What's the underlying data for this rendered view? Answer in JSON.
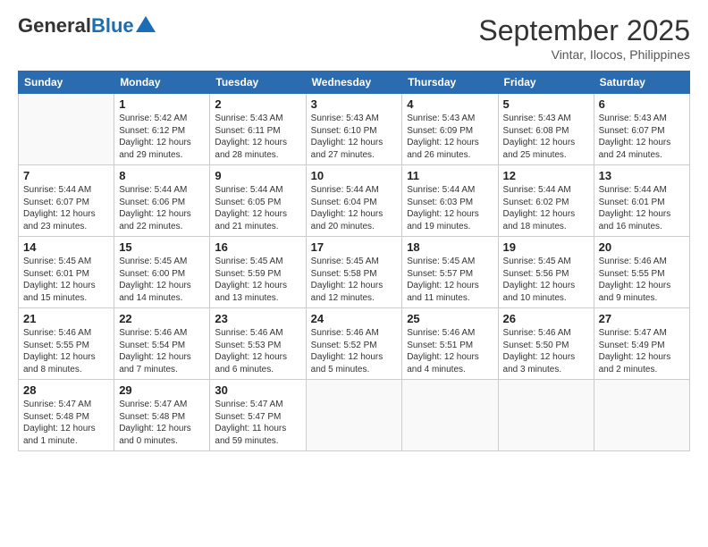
{
  "header": {
    "logo_general": "General",
    "logo_blue": "Blue",
    "month": "September 2025",
    "location": "Vintar, Ilocos, Philippines"
  },
  "days_of_week": [
    "Sunday",
    "Monday",
    "Tuesday",
    "Wednesday",
    "Thursday",
    "Friday",
    "Saturday"
  ],
  "weeks": [
    [
      {
        "day": "",
        "info": ""
      },
      {
        "day": "1",
        "info": "Sunrise: 5:42 AM\nSunset: 6:12 PM\nDaylight: 12 hours\nand 29 minutes."
      },
      {
        "day": "2",
        "info": "Sunrise: 5:43 AM\nSunset: 6:11 PM\nDaylight: 12 hours\nand 28 minutes."
      },
      {
        "day": "3",
        "info": "Sunrise: 5:43 AM\nSunset: 6:10 PM\nDaylight: 12 hours\nand 27 minutes."
      },
      {
        "day": "4",
        "info": "Sunrise: 5:43 AM\nSunset: 6:09 PM\nDaylight: 12 hours\nand 26 minutes."
      },
      {
        "day": "5",
        "info": "Sunrise: 5:43 AM\nSunset: 6:08 PM\nDaylight: 12 hours\nand 25 minutes."
      },
      {
        "day": "6",
        "info": "Sunrise: 5:43 AM\nSunset: 6:07 PM\nDaylight: 12 hours\nand 24 minutes."
      }
    ],
    [
      {
        "day": "7",
        "info": "Sunrise: 5:44 AM\nSunset: 6:07 PM\nDaylight: 12 hours\nand 23 minutes."
      },
      {
        "day": "8",
        "info": "Sunrise: 5:44 AM\nSunset: 6:06 PM\nDaylight: 12 hours\nand 22 minutes."
      },
      {
        "day": "9",
        "info": "Sunrise: 5:44 AM\nSunset: 6:05 PM\nDaylight: 12 hours\nand 21 minutes."
      },
      {
        "day": "10",
        "info": "Sunrise: 5:44 AM\nSunset: 6:04 PM\nDaylight: 12 hours\nand 20 minutes."
      },
      {
        "day": "11",
        "info": "Sunrise: 5:44 AM\nSunset: 6:03 PM\nDaylight: 12 hours\nand 19 minutes."
      },
      {
        "day": "12",
        "info": "Sunrise: 5:44 AM\nSunset: 6:02 PM\nDaylight: 12 hours\nand 18 minutes."
      },
      {
        "day": "13",
        "info": "Sunrise: 5:44 AM\nSunset: 6:01 PM\nDaylight: 12 hours\nand 16 minutes."
      }
    ],
    [
      {
        "day": "14",
        "info": "Sunrise: 5:45 AM\nSunset: 6:01 PM\nDaylight: 12 hours\nand 15 minutes."
      },
      {
        "day": "15",
        "info": "Sunrise: 5:45 AM\nSunset: 6:00 PM\nDaylight: 12 hours\nand 14 minutes."
      },
      {
        "day": "16",
        "info": "Sunrise: 5:45 AM\nSunset: 5:59 PM\nDaylight: 12 hours\nand 13 minutes."
      },
      {
        "day": "17",
        "info": "Sunrise: 5:45 AM\nSunset: 5:58 PM\nDaylight: 12 hours\nand 12 minutes."
      },
      {
        "day": "18",
        "info": "Sunrise: 5:45 AM\nSunset: 5:57 PM\nDaylight: 12 hours\nand 11 minutes."
      },
      {
        "day": "19",
        "info": "Sunrise: 5:45 AM\nSunset: 5:56 PM\nDaylight: 12 hours\nand 10 minutes."
      },
      {
        "day": "20",
        "info": "Sunrise: 5:46 AM\nSunset: 5:55 PM\nDaylight: 12 hours\nand 9 minutes."
      }
    ],
    [
      {
        "day": "21",
        "info": "Sunrise: 5:46 AM\nSunset: 5:55 PM\nDaylight: 12 hours\nand 8 minutes."
      },
      {
        "day": "22",
        "info": "Sunrise: 5:46 AM\nSunset: 5:54 PM\nDaylight: 12 hours\nand 7 minutes."
      },
      {
        "day": "23",
        "info": "Sunrise: 5:46 AM\nSunset: 5:53 PM\nDaylight: 12 hours\nand 6 minutes."
      },
      {
        "day": "24",
        "info": "Sunrise: 5:46 AM\nSunset: 5:52 PM\nDaylight: 12 hours\nand 5 minutes."
      },
      {
        "day": "25",
        "info": "Sunrise: 5:46 AM\nSunset: 5:51 PM\nDaylight: 12 hours\nand 4 minutes."
      },
      {
        "day": "26",
        "info": "Sunrise: 5:46 AM\nSunset: 5:50 PM\nDaylight: 12 hours\nand 3 minutes."
      },
      {
        "day": "27",
        "info": "Sunrise: 5:47 AM\nSunset: 5:49 PM\nDaylight: 12 hours\nand 2 minutes."
      }
    ],
    [
      {
        "day": "28",
        "info": "Sunrise: 5:47 AM\nSunset: 5:48 PM\nDaylight: 12 hours\nand 1 minute."
      },
      {
        "day": "29",
        "info": "Sunrise: 5:47 AM\nSunset: 5:48 PM\nDaylight: 12 hours\nand 0 minutes."
      },
      {
        "day": "30",
        "info": "Sunrise: 5:47 AM\nSunset: 5:47 PM\nDaylight: 11 hours\nand 59 minutes."
      },
      {
        "day": "",
        "info": ""
      },
      {
        "day": "",
        "info": ""
      },
      {
        "day": "",
        "info": ""
      },
      {
        "day": "",
        "info": ""
      }
    ]
  ]
}
